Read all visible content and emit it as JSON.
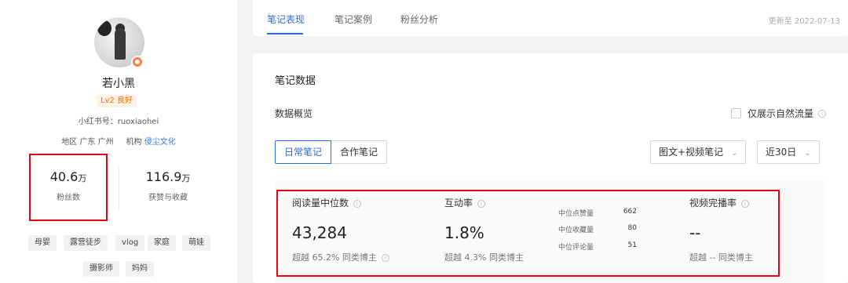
{
  "profile": {
    "name": "若小黑",
    "level": "Lv2 良好",
    "red_id_label": "小红书号：",
    "red_id": "ruoxiaohei",
    "region_label": "地区",
    "region": "广东 广州",
    "agency_label": "机构",
    "agency": "侵尘文化",
    "avatar_badge_icon": "person-icon"
  },
  "stats": [
    {
      "value": "40.6",
      "unit": "万",
      "label": "粉丝数"
    },
    {
      "value": "116.9",
      "unit": "万",
      "label": "获赞与收藏"
    }
  ],
  "tags": [
    "母婴",
    "露营徒步",
    "vlog",
    "家庭",
    "萌娃",
    "摄影师",
    "妈妈"
  ],
  "tabs": [
    {
      "label": "笔记表现",
      "active": true
    },
    {
      "label": "笔记案例",
      "active": false
    },
    {
      "label": "粉丝分析",
      "active": false
    }
  ],
  "update_text": "更新至 2022-07-13",
  "main": {
    "title": "笔记数据",
    "overview": "数据概览",
    "natural_traffic_label": "仅展示自然流量",
    "segment": [
      "日常笔记",
      "合作笔记"
    ],
    "content_type": "图文+视频笔记",
    "period": "近30日"
  },
  "metrics": {
    "read": {
      "label": "阅读量中位数",
      "value": "43,284",
      "foot": "超越 65.2% 同类博主"
    },
    "interaction": {
      "label": "互动率",
      "value": "1.8%",
      "foot": "超越 4.3% 同类博主"
    },
    "sub": [
      {
        "label": "中位点赞量",
        "value": "662"
      },
      {
        "label": "中位收藏量",
        "value": "80"
      },
      {
        "label": "中位评论量",
        "value": "51"
      }
    ],
    "video": {
      "label": "视频完播率",
      "value": "--",
      "foot": "超越 -- 同类博主"
    }
  },
  "colors": {
    "accent": "#2f6bd8",
    "highlight_box": "#e60012",
    "level": "#ff6a00"
  }
}
